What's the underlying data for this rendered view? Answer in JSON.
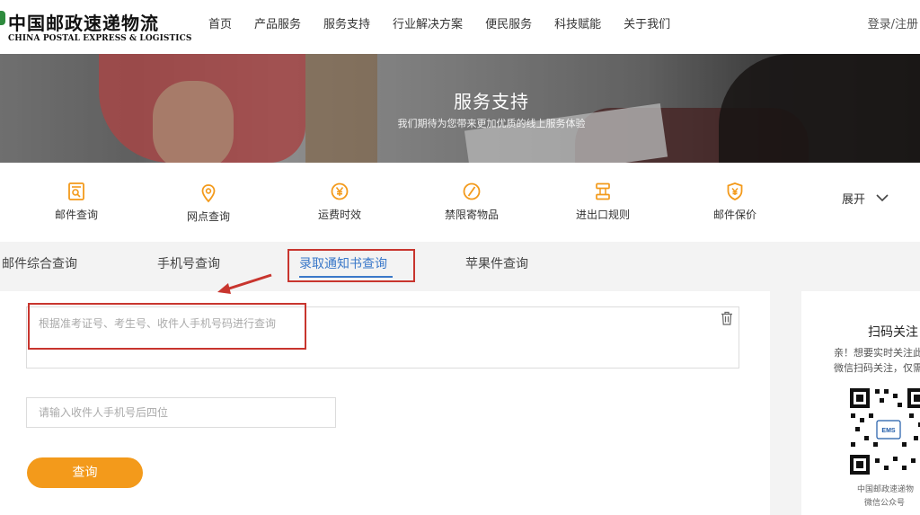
{
  "header": {
    "logo_cn": "中国邮政速递物流",
    "logo_en": "CHINA POSTAL EXPRESS & LOGISTICS",
    "nav": [
      "首页",
      "产品服务",
      "服务支持",
      "行业解决方案",
      "便民服务",
      "科技赋能",
      "关于我们"
    ],
    "login": "登录/注册"
  },
  "banner": {
    "title": "服务支持",
    "subtitle": "我们期待为您带来更加优质的线上服务体验"
  },
  "services": {
    "items": [
      {
        "label": "邮件查询",
        "icon": "mail-search-icon"
      },
      {
        "label": "网点查询",
        "icon": "location-pin-icon"
      },
      {
        "label": "运费时效",
        "icon": "yen-coin-icon"
      },
      {
        "label": "禁限寄物品",
        "icon": "prohibited-icon"
      },
      {
        "label": "进出口规则",
        "icon": "import-export-icon"
      },
      {
        "label": "邮件保价",
        "icon": "shield-yen-icon"
      }
    ],
    "expand": "展开",
    "accent_color": "#f39a1b"
  },
  "tabs": {
    "items": [
      "邮件综合查询",
      "手机号查询",
      "录取通知书查询",
      "苹果件查询"
    ],
    "active_index": 2,
    "active_color": "#3a78c9"
  },
  "form": {
    "textarea_placeholder": "根据准考证号、考生号、收件人手机号码进行查询",
    "phone_placeholder": "请输入收件人手机号后四位",
    "submit": "查询",
    "button_color": "#f39a1b"
  },
  "sidebar": {
    "title": "扫码关注",
    "text1": "亲！想要实时关注此",
    "text2": "微信扫码关注，仅需",
    "caption1": "中国邮政速递物",
    "caption2": "微信公众号"
  },
  "annotation_color": "#c8352e"
}
